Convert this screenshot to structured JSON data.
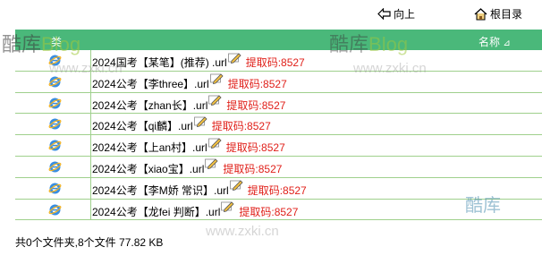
{
  "nav": {
    "up_label": "向上",
    "root_label": "根目录"
  },
  "table": {
    "col_type": "类",
    "col_name": "名称",
    "sort_indicator": "⊿",
    "rows": [
      {
        "name": "2024国考【某笔】(推荐) .url",
        "code": "提取码:8527"
      },
      {
        "name": "2024公考【李three】.url",
        "code": "提取码:8527"
      },
      {
        "name": "2024公考【zhan长】.url",
        "code": "提取码:8527"
      },
      {
        "name": "2024公考【qi麟】.url",
        "code": "提取码:8527"
      },
      {
        "name": "2024公考【上an村】.url",
        "code": "提取码:8527"
      },
      {
        "name": "2024公考【xiao宝】.url",
        "code": "提取码:8527"
      },
      {
        "name": "2024公考【李M娇 常识】.url",
        "code": "提取码:8527"
      },
      {
        "name": "2024公考【龙fei 判断】.url",
        "code": "提取码:8527"
      }
    ]
  },
  "footer": {
    "summary": "共0个文件夹,8个文件 77.82 KB"
  },
  "watermarks": {
    "brand_cn": "酷库",
    "brand_en": "Blog",
    "url": "www.zxki.cn"
  },
  "colors": {
    "header_bg": "#4ab87a",
    "row_border": "#9fd08c",
    "code_red": "#e0201a"
  }
}
